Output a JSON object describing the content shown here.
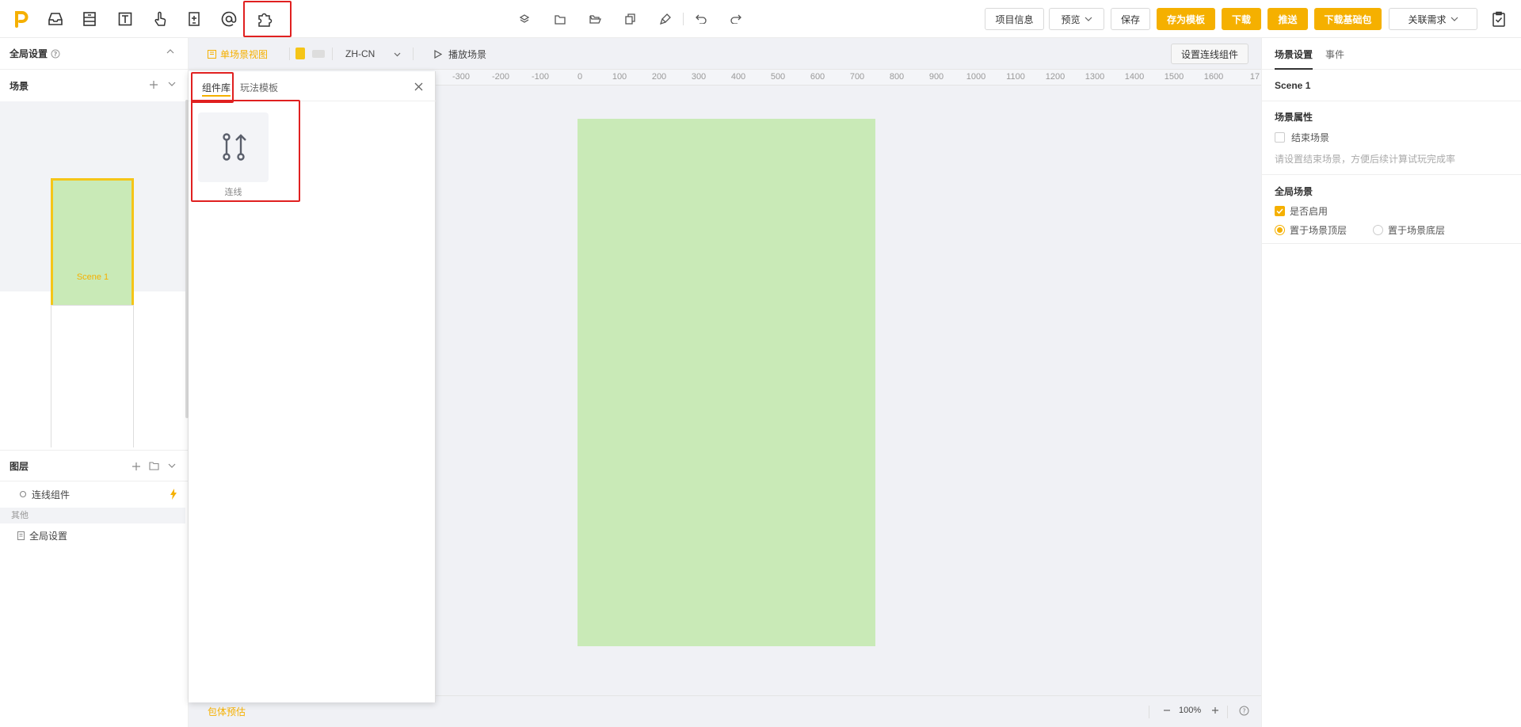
{
  "toolbar": {
    "left_icons": [
      "logo-icon",
      "inbox-icon",
      "layout-icon",
      "text-icon",
      "touch-icon",
      "component-icon",
      "at-icon",
      "puzzle-icon"
    ],
    "center_icons": [
      "layers-icon",
      "folder-icon",
      "folder-open-icon",
      "copy-icon",
      "brush-icon",
      "undo-icon",
      "redo-icon"
    ],
    "project_info": "项目信息",
    "preview": "预览",
    "save": "保存",
    "save_template": "存为模板",
    "download": "下载",
    "push": "推送",
    "download_base": "下载基础包",
    "link_requirement": "关联需求"
  },
  "left": {
    "global_settings": "全局设置",
    "scenes_title": "场景",
    "scene1_name": "Scene 1",
    "layers_title": "图层",
    "layer_item": "连线组件",
    "other_title": "其他",
    "other_item": "全局设置"
  },
  "canvas_controls": {
    "single_view": "单场景视图",
    "language": "ZH-CN",
    "play_scene": "播放场景",
    "set_connect": "设置连线组件"
  },
  "ruler": [
    "-300",
    "-200",
    "-100",
    "0",
    "100",
    "200",
    "300",
    "400",
    "500",
    "600",
    "700",
    "800",
    "900",
    "1000",
    "1100",
    "1200",
    "1300",
    "1400",
    "1500",
    "1600",
    "17"
  ],
  "popup": {
    "tab_library": "组件库",
    "tab_templates": "玩法模板",
    "item_label": "连线"
  },
  "bottom": {
    "package_estimate": "包体预估",
    "zoom": "100%"
  },
  "right": {
    "tab_scene_settings": "场景设置",
    "tab_events": "事件",
    "scene_name": "Scene 1",
    "scene_props_title": "场景属性",
    "end_scene": "结束场景",
    "hint": "请设置结束场景，方便后续计算试玩完成率",
    "global_scene_title": "全局场景",
    "enable": "是否启用",
    "top_layer": "置于场景顶层",
    "bottom_layer": "置于场景底层"
  },
  "colors": {
    "accent": "#f5b000",
    "stage_bg": "#c9eab7",
    "highlight": "#e02020"
  }
}
